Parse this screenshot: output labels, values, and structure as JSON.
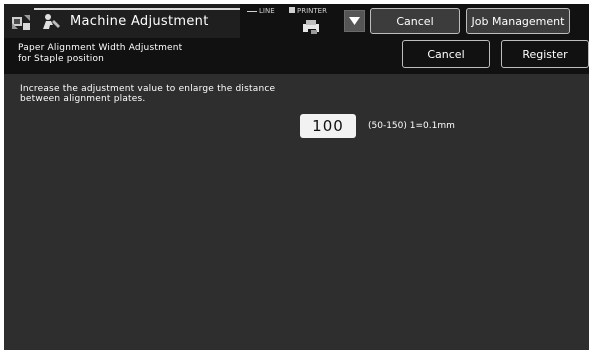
{
  "header": {
    "title": "Machine Adjustment",
    "line_label": "LINE",
    "printer_label": "PRINTER",
    "cancel_label": "Cancel",
    "job_management_label": "Job Management",
    "app_icon": "machine-adjustment-icon",
    "person_icon": "person-icon",
    "printer_icon": "printer-status-icon",
    "dropdown_icon": "triangle-down-icon"
  },
  "subheader": {
    "title_line1": "Paper Alignment Width Adjustment",
    "title_line2": "for Staple position",
    "cancel_label": "Cancel",
    "register_label": "Register"
  },
  "content": {
    "description_line1": "Increase the adjustment value to enlarge the distance",
    "description_line2": "between alignment plates.",
    "value": "100",
    "range_text": "(50-150) 1=0.1mm"
  },
  "colors": {
    "background": "#2e2e2e",
    "header": "#111111",
    "text": "#ffffff",
    "value_box": "#f2f2f2"
  }
}
